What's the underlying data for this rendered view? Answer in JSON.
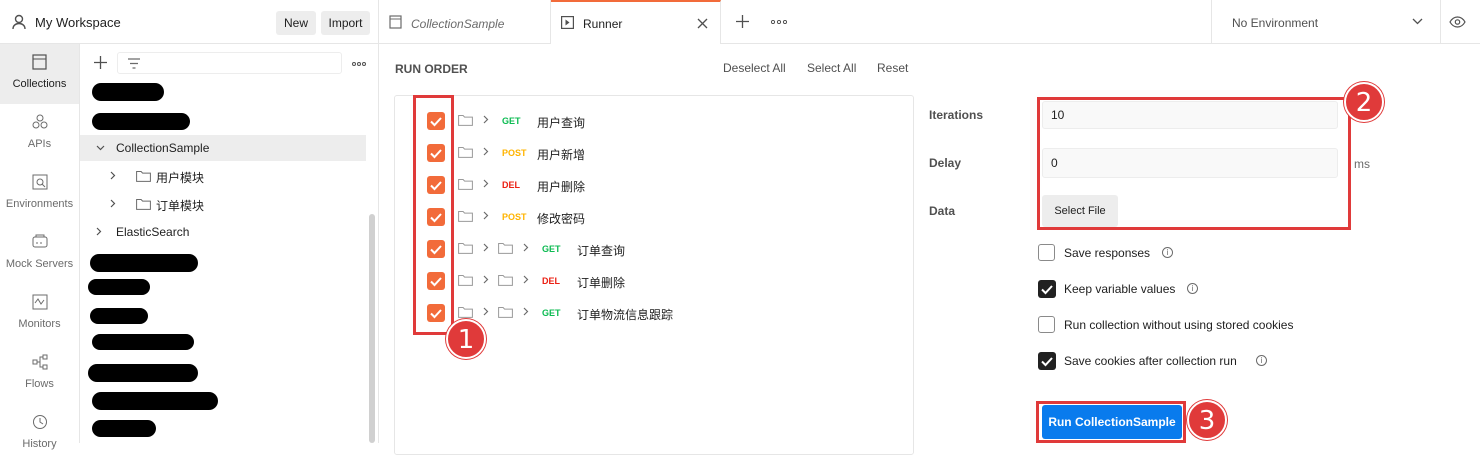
{
  "workspace": {
    "title": "My Workspace",
    "new_label": "New",
    "import_label": "Import"
  },
  "tabs": [
    {
      "label": "CollectionSample",
      "icon": "collection-icon"
    },
    {
      "label": "Runner",
      "icon": "runner-icon"
    }
  ],
  "environment": {
    "label": "No Environment"
  },
  "nav": [
    {
      "label": "Collections",
      "icon": "collections-icon",
      "active": true
    },
    {
      "label": "APIs",
      "icon": "apis-icon"
    },
    {
      "label": "Environments",
      "icon": "environments-icon"
    },
    {
      "label": "Mock Servers",
      "icon": "mock-servers-icon"
    },
    {
      "label": "Monitors",
      "icon": "monitors-icon"
    },
    {
      "label": "Flows",
      "icon": "flows-icon"
    },
    {
      "label": "History",
      "icon": "history-icon"
    }
  ],
  "sidebar": {
    "tree": [
      {
        "label": "CollectionSample",
        "expanded": true,
        "selected": true
      },
      {
        "label": "用户模块",
        "folder": true
      },
      {
        "label": "订单模块",
        "folder": true
      },
      {
        "label": "ElasticSearch"
      }
    ]
  },
  "runner": {
    "heading": "RUN ORDER",
    "deselect_all": "Deselect All",
    "select_all": "Select All",
    "reset": "Reset",
    "requests": [
      {
        "method": "GET",
        "name": "用户查询",
        "nested": false,
        "checked": true
      },
      {
        "method": "POST",
        "name": "用户新增",
        "nested": false,
        "checked": true
      },
      {
        "method": "DEL",
        "name": "用户删除",
        "nested": false,
        "checked": true
      },
      {
        "method": "POST",
        "name": "修改密码",
        "nested": false,
        "checked": true
      },
      {
        "method": "GET",
        "name": "订单查询",
        "nested": true,
        "checked": true
      },
      {
        "method": "DEL",
        "name": "订单删除",
        "nested": true,
        "checked": true
      },
      {
        "method": "GET",
        "name": "订单物流信息跟踪",
        "nested": true,
        "checked": true
      }
    ],
    "iterations_label": "Iterations",
    "iterations_value": "10",
    "delay_label": "Delay",
    "delay_value": "0",
    "delay_unit": "ms",
    "data_label": "Data",
    "select_file_label": "Select File",
    "options": [
      {
        "label": "Save responses",
        "checked": false
      },
      {
        "label": "Keep variable values",
        "checked": true
      },
      {
        "label": "Run collection without using stored cookies",
        "checked": false
      },
      {
        "label": "Save cookies after collection run",
        "checked": true
      }
    ],
    "run_button": "Run CollectionSample"
  },
  "annotations": [
    "1",
    "2",
    "3"
  ],
  "colors": {
    "accent": "#f26b3a",
    "run_button": "#097bed",
    "annotation": "#e03a3a"
  }
}
